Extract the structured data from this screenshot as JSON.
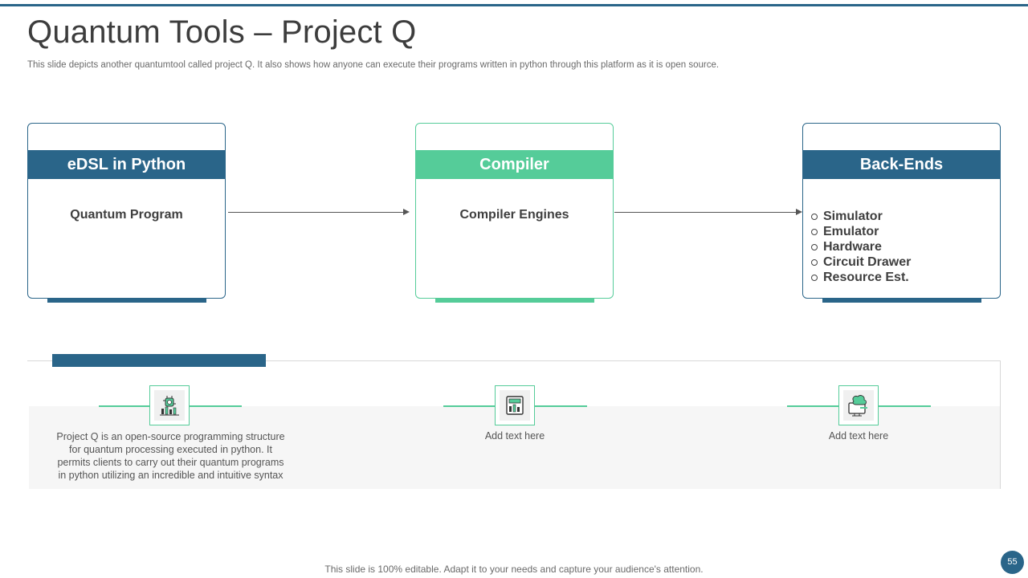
{
  "header": {
    "title": "Quantum Tools – Project Q",
    "subtitle": "This slide depicts another quantumtool called project Q. It also shows how anyone can execute their programs written in python through this platform as it is open source."
  },
  "cards": [
    {
      "heading": "eDSL in Python",
      "body": "Quantum Program"
    },
    {
      "heading": "Compiler",
      "body": "Compiler Engines"
    },
    {
      "heading": "Back-Ends",
      "items": [
        "Simulator",
        "Emulator",
        "Hardware",
        "Circuit Drawer",
        "Resource Est."
      ]
    }
  ],
  "panel": {
    "items": [
      {
        "icon": "quantum-chip-icon",
        "lines": [
          "Project Q is an open-source programming structure",
          "for quantum processing executed in python. It",
          "permits clients to carry out their quantum programs",
          "in python utilizing an incredible and intuitive syntax"
        ]
      },
      {
        "icon": "data-report-icon",
        "text": "Add text here"
      },
      {
        "icon": "computer-brain-icon",
        "text": "Add text here"
      }
    ]
  },
  "footer": {
    "note": "This slide is 100% editable. Adapt it to your needs and capture your audience's attention.",
    "page_number": "55"
  },
  "colors": {
    "blue": "#2a6589",
    "green": "#55cc99"
  }
}
